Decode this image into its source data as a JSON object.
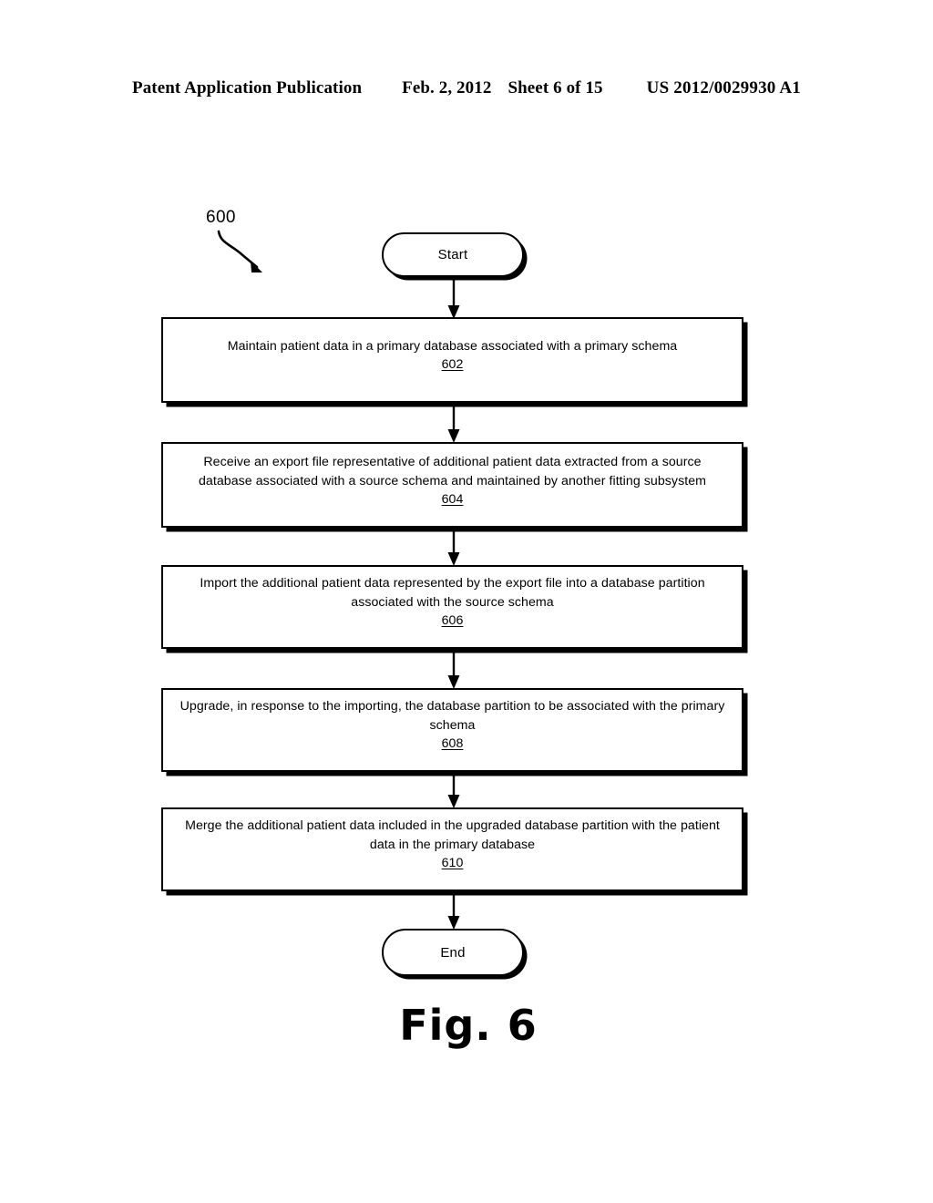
{
  "header": {
    "publication": "Patent Application Publication",
    "date": "Feb. 2, 2012",
    "sheet": "Sheet 6 of 15",
    "document_number": "US 2012/0029930 A1"
  },
  "figure": {
    "caption": "Fig. 6",
    "reference_callout": "600",
    "start_label": "Start",
    "end_label": "End",
    "steps": [
      {
        "text": "Maintain patient data in a primary database associated with a primary schema",
        "ref": "602"
      },
      {
        "text": "Receive an export file representative of additional patient data extracted from a source database associated with a source schema and maintained by another fitting subsystem",
        "ref": "604"
      },
      {
        "text": "Import the additional patient data represented by the export file into a database partition associated with the source schema",
        "ref": "606"
      },
      {
        "text": "Upgrade, in response to the importing, the database partition to be associated with the primary schema",
        "ref": "608"
      },
      {
        "text": "Merge the additional patient data included in the upgraded database partition with the patient data in the primary database",
        "ref": "610"
      }
    ]
  },
  "colors": {
    "ink": "#000000",
    "paper": "#ffffff"
  }
}
